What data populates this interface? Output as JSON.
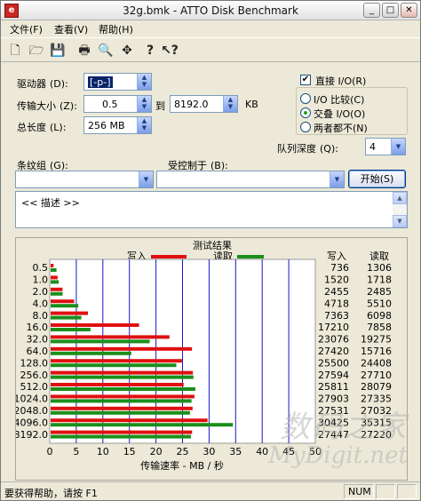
{
  "window": {
    "title": "32g.bmk - ATTO Disk Benchmark",
    "app_icon": "atto-icon",
    "buttons": {
      "minimize": "minimize-icon",
      "maximize": "maximize-icon",
      "close": "close-icon"
    }
  },
  "menu": {
    "file": "文件(F)",
    "view": "查看(V)",
    "help": "帮助(H)"
  },
  "toolbar": [
    "new-icon",
    "open-icon",
    "save-icon",
    "print-icon",
    "print-preview-icon",
    "move-icon",
    "help-icon",
    "context-help-icon"
  ],
  "form": {
    "drive_label": "驱动器",
    "drive_hotkey": "(D):",
    "drive_value": "[-p-]",
    "transfer_label": "传输大小",
    "transfer_hotkey": "(Z):",
    "transfer_from": "0.5",
    "to_label": "到",
    "transfer_to": "8192.0",
    "kb_label": "KB",
    "total_label": "总长度",
    "total_hotkey": "(L):",
    "total_value": "256 MB",
    "direct_io_label": "直接 I/O(R)",
    "direct_io_checked": true,
    "radio_compare": "I/O 比较(C)",
    "radio_overlap": "交叠 I/O(O)",
    "radio_neither": "两者都不(N)",
    "radio_selected": "overlap",
    "queue_label": "队列深度",
    "queue_hotkey": "(Q):",
    "queue_value": "4",
    "stripe_label": "条纹组",
    "stripe_hotkey": "(G):",
    "stripe_value": "",
    "controlled_label": "受控制于",
    "controlled_hotkey": "(B):",
    "controlled_value": "",
    "start_button": "开始(S)",
    "description": "<< 描述 >>"
  },
  "results": {
    "title": "测试结果",
    "legend_write": "写入",
    "legend_read": "读取",
    "col_write": "写入",
    "col_read": "读取",
    "xlabel": "传输速率 - MB / 秒"
  },
  "chart_data": {
    "type": "bar",
    "orientation": "horizontal",
    "title": "测试结果",
    "xlabel": "传输速率 - MB / 秒",
    "xlim": [
      0,
      50
    ],
    "xticks": [
      0,
      5,
      10,
      15,
      20,
      25,
      30,
      35,
      40,
      45,
      50
    ],
    "categories": [
      "0.5",
      "1.0",
      "2.0",
      "4.0",
      "8.0",
      "16.0",
      "32.0",
      "64.0",
      "128.0",
      "256.0",
      "512.0",
      "1024.0",
      "2048.0",
      "4096.0",
      "8192.0"
    ],
    "series": [
      {
        "name": "写入",
        "color": "#e01010",
        "values": [
          0.72,
          1.48,
          2.4,
          4.61,
          7.19,
          16.81,
          22.54,
          26.78,
          24.9,
          26.95,
          25.21,
          27.25,
          26.89,
          29.71,
          26.8
        ],
        "labels": [
          "736",
          "1520",
          "2455",
          "4718",
          "7363",
          "17210",
          "23076",
          "27420",
          "25500",
          "27594",
          "25811",
          "27903",
          "27531",
          "30425",
          "27447"
        ]
      },
      {
        "name": "读取",
        "color": "#1a8f1a",
        "values": [
          1.27,
          1.68,
          2.43,
          5.38,
          5.95,
          7.67,
          18.82,
          15.35,
          23.84,
          27.06,
          27.42,
          26.69,
          26.4,
          34.49,
          26.58
        ],
        "labels": [
          "1306",
          "1718",
          "2485",
          "5510",
          "6098",
          "7858",
          "19275",
          "15716",
          "24408",
          "27710",
          "28079",
          "27335",
          "27032",
          "35315",
          "27220"
        ]
      }
    ],
    "grid": true
  },
  "status": {
    "text": "要获得帮助，请按 F1",
    "num": "NUM"
  },
  "watermark": {
    "line1": "数码之家",
    "line2": "MyDigit.net"
  },
  "colors": {
    "write": "#e01010",
    "read": "#1a8f1a",
    "grid": "#1818c8",
    "plot_bg": "#ffffff"
  }
}
